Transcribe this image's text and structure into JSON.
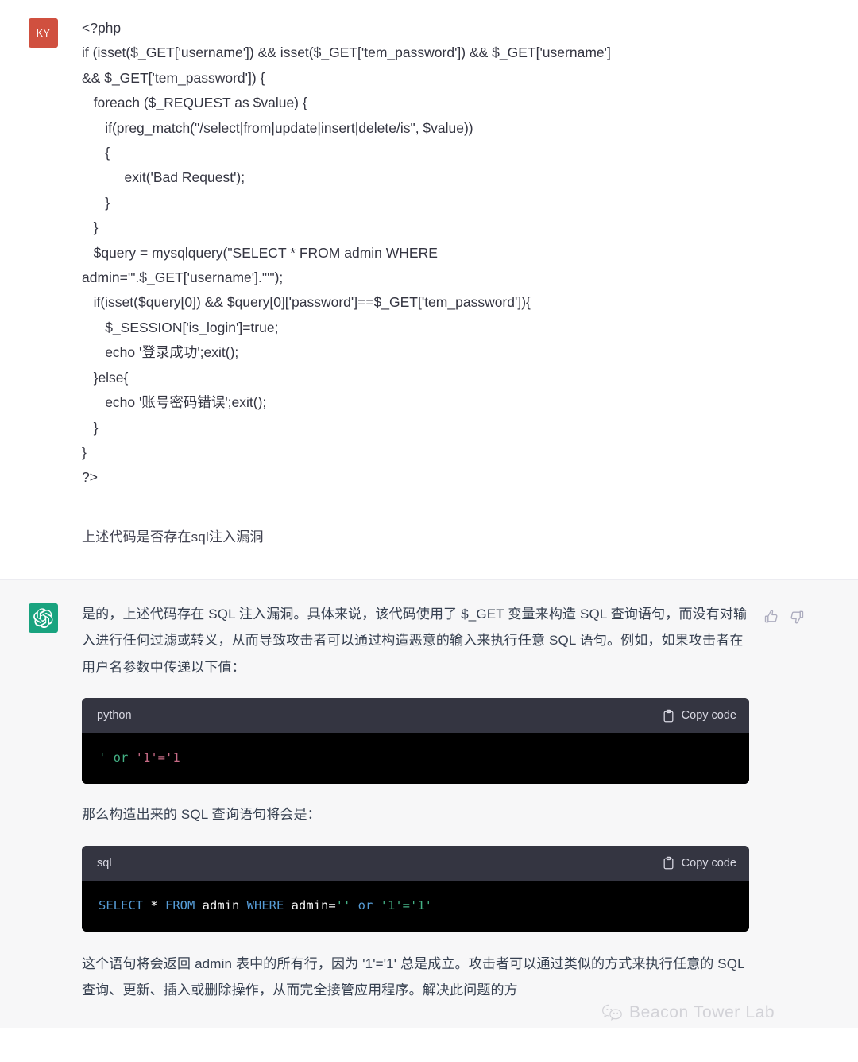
{
  "user_message": {
    "avatar_initials": "KY",
    "avatar_color": "#d0503f",
    "code": "<?php\nif (isset($_GET['username']) && isset($_GET['tem_password']) && $_GET['username']\n&& $_GET['tem_password']) {\n   foreach ($_REQUEST as $value) {\n      if(preg_match(\"/select|from|update|insert|delete/is\", $value))\n      {\n           exit('Bad Request');\n      }\n   }\n   $query = mysqlquery(\"SELECT * FROM admin WHERE\nadmin='\".$_GET['username'].\"'\");\n   if(isset($query[0]) && $query[0]['password']==$_GET['tem_password']){\n      $_SESSION['is_login']=true;\n      echo '登录成功';exit();\n   }else{\n      echo '账号密码错误';exit();\n   }\n}\n?>",
    "question": "上述代码是否存在sql注入漏洞"
  },
  "assistant_message": {
    "avatar_color": "#19a37f",
    "avatar_icon": "openai-logo-icon",
    "paragraph_1": "是的，上述代码存在 SQL 注入漏洞。具体来说，该代码使用了 $_GET 变量来构造 SQL 查询语句，而没有对输入进行任何过滤或转义，从而导致攻击者可以通过构造恶意的输入来执行任意 SQL 语句。例如，如果攻击者在用户名参数中传递以下值：",
    "paragraph_2": "那么构造出来的 SQL 查询语句将会是：",
    "paragraph_3": "这个语句将会返回 admin 表中的所有行，因为 '1'='1' 总是成立。攻击者可以通过类似的方式来执行任意的 SQL 查询、更新、插入或删除操作，从而完全接管应用程序。解决此问题的方",
    "feedback": {
      "thumbs_up_icon": "thumbs-up-icon",
      "thumbs_down_icon": "thumbs-down-icon"
    },
    "code_blocks": [
      {
        "language": "python",
        "copy_label": "Copy code",
        "copy_icon": "clipboard-icon",
        "tokens": [
          {
            "text": "' or ",
            "type": "str"
          },
          {
            "text": "'1'='1",
            "type": "num"
          }
        ]
      },
      {
        "language": "sql",
        "copy_label": "Copy code",
        "copy_icon": "clipboard-icon",
        "tokens": [
          {
            "text": "SELECT ",
            "type": "kw"
          },
          {
            "text": "* ",
            "type": "op"
          },
          {
            "text": "FROM ",
            "type": "kw"
          },
          {
            "text": "admin ",
            "type": "id"
          },
          {
            "text": "WHERE ",
            "type": "kw"
          },
          {
            "text": "admin=",
            "type": "id"
          },
          {
            "text": "'' ",
            "type": "str"
          },
          {
            "text": "or ",
            "type": "kw"
          },
          {
            "text": "'1'='1'",
            "type": "str"
          }
        ]
      }
    ]
  },
  "watermark": {
    "text": "Beacon Tower Lab",
    "icon": "wechat-icon"
  },
  "colors": {
    "user_bg": "#ffffff",
    "assistant_bg": "#f7f7f8",
    "code_header_bg": "#343541",
    "code_body_bg": "#000000",
    "accent_green": "#19a37f",
    "string_green": "#44b185",
    "keyword_blue": "#569cd6",
    "number_pink": "#c76b86"
  }
}
